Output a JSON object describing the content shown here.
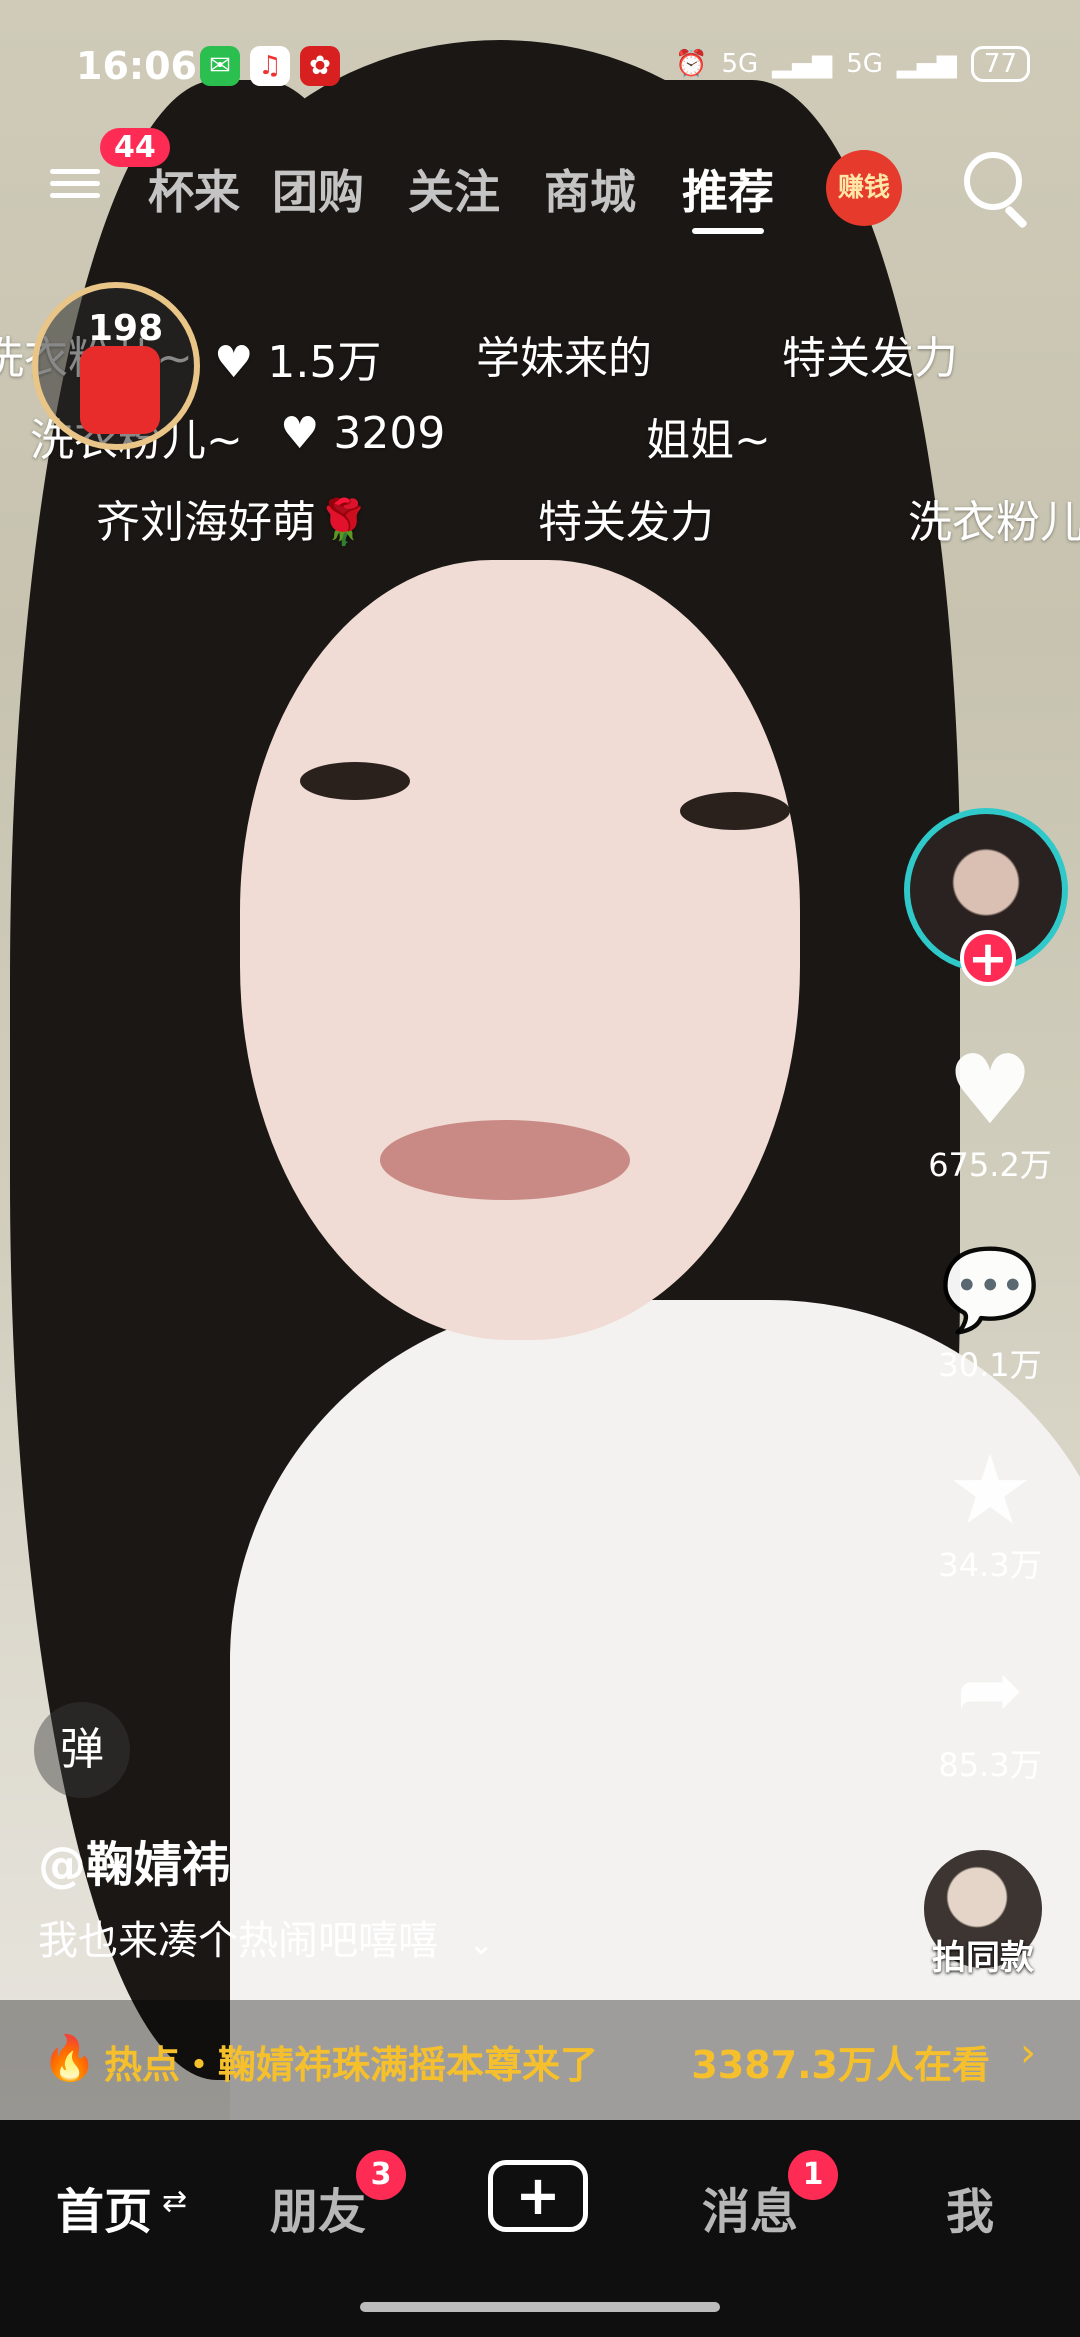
{
  "status_bar": {
    "time": "16:06",
    "battery": "77",
    "signal1": "5G",
    "signal2": "5G"
  },
  "top_nav": {
    "menu_badge": "44",
    "tabs": [
      {
        "label": "杯来"
      },
      {
        "label": "团购"
      },
      {
        "label": "关注"
      },
      {
        "label": "商城"
      },
      {
        "label": "推荐"
      }
    ],
    "earn_label": "赚钱"
  },
  "red_packet": {
    "count": "198"
  },
  "danmu": [
    {
      "text": "洗衣粉儿~"
    },
    {
      "text": "♥ 1.5万"
    },
    {
      "text": "学妹来的"
    },
    {
      "text": "特关发力"
    },
    {
      "text": "洗衣粉儿~"
    },
    {
      "text": "♥ 3209"
    },
    {
      "text": "姐姐~"
    },
    {
      "text": "齐刘海好萌🌹"
    },
    {
      "text": "特关发力"
    },
    {
      "text": "洗衣粉儿"
    }
  ],
  "side_actions": {
    "like_count": "675.2万",
    "comment_count": "30.1万",
    "favorite_count": "34.3万",
    "share_count": "85.3万",
    "follow_label": "+",
    "same_style_label": "拍同款"
  },
  "danmu_toggle": "弹",
  "author": "@鞠婧祎",
  "caption": "我也来凑个热闹吧嘻嘻",
  "hot_bar": {
    "text": "热点・鞠婧祎珠满摇本尊来了",
    "viewers": "3387.3万人在看",
    "arrow": "›"
  },
  "bottom_nav": {
    "home": "首页",
    "friends": "朋友",
    "friends_badge": "3",
    "plus": "+",
    "messages": "消息",
    "messages_badge": "1",
    "me": "我"
  }
}
